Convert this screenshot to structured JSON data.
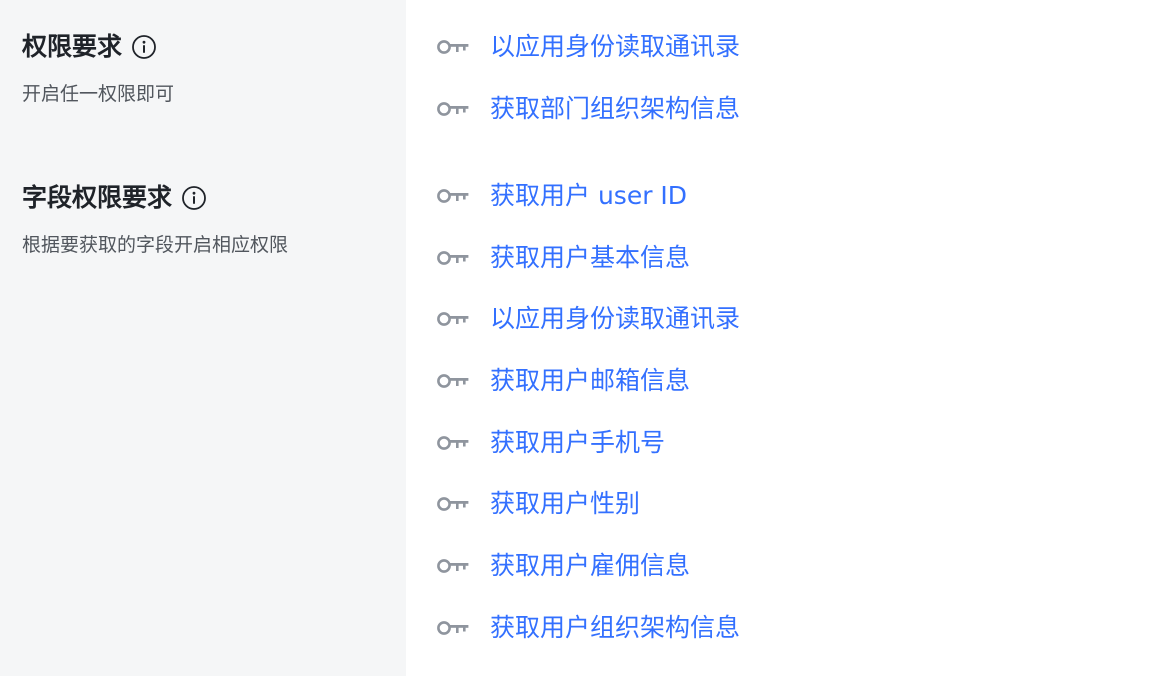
{
  "sections": [
    {
      "title": "权限要求",
      "subtitle": "开启任一权限即可",
      "permissions": [
        "以应用身份读取通讯录",
        "获取部门组织架构信息"
      ]
    },
    {
      "title": "字段权限要求",
      "subtitle": "根据要获取的字段开启相应权限",
      "permissions": [
        "获取用户 user ID",
        "获取用户基本信息",
        "以应用身份读取通讯录",
        "获取用户邮箱信息",
        "获取用户手机号",
        "获取用户性别",
        "获取用户雇佣信息",
        "获取用户组织架构信息"
      ]
    }
  ],
  "icons": {
    "info": "info-circle-icon",
    "permission": "key-icon"
  },
  "colors": {
    "link": "#3370ff",
    "left_background": "#f5f6f7",
    "icon": "#8f959e",
    "title": "#1f2329",
    "subtitle": "#51565d",
    "divider": "#e4e6ea"
  }
}
